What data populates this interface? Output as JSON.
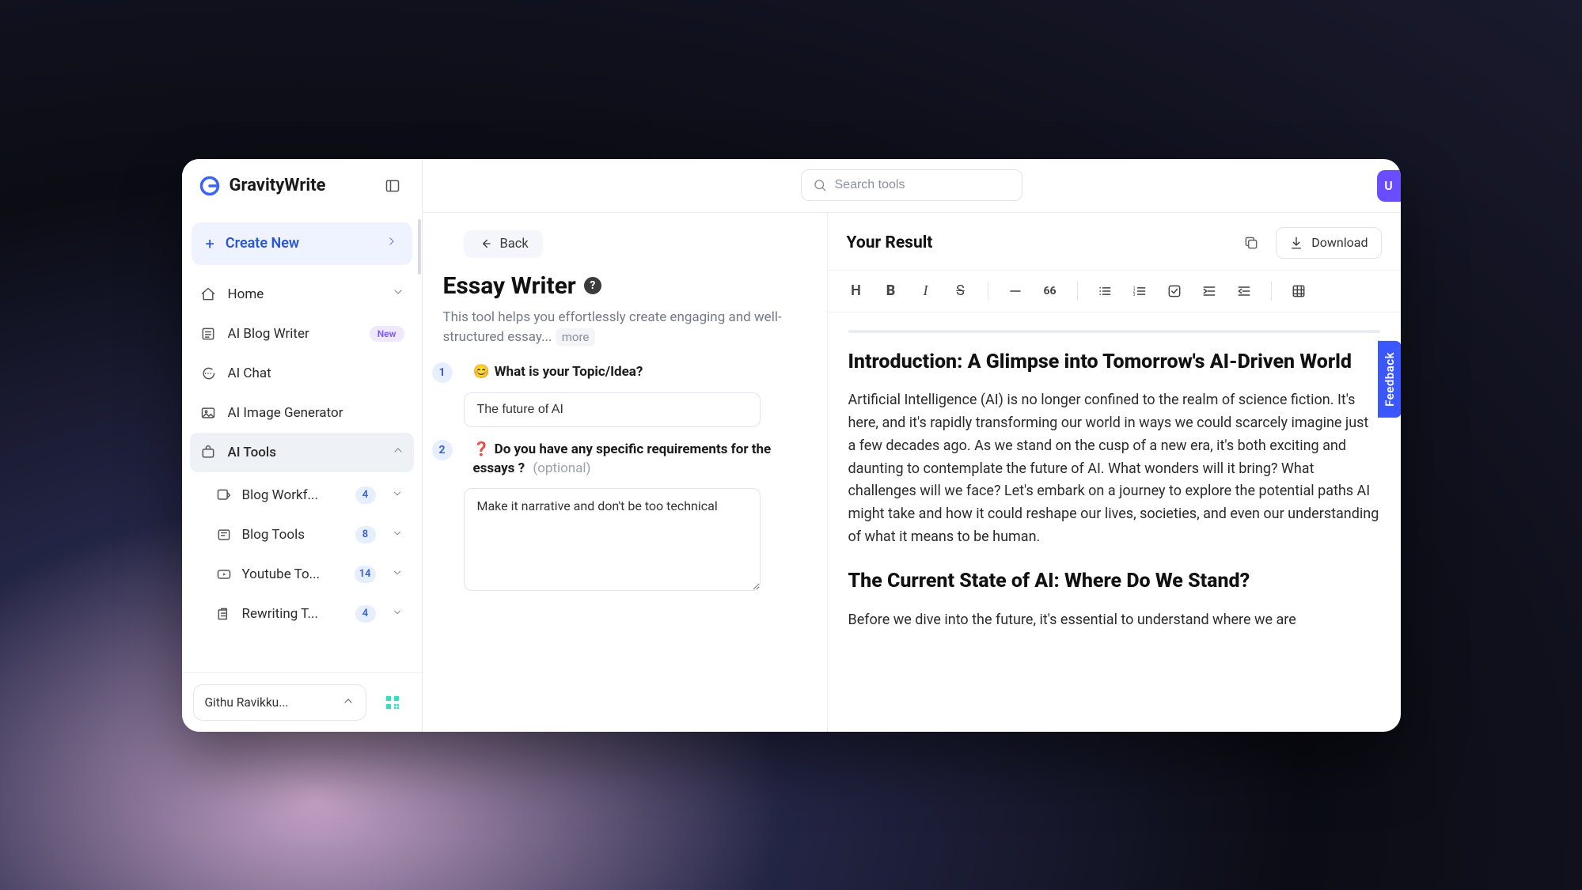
{
  "brand": {
    "name": "GravityWrite"
  },
  "search": {
    "placeholder": "Search tools"
  },
  "upgrade": {
    "label_initial": "U"
  },
  "sidebar": {
    "create_new": "Create New",
    "items": [
      {
        "label": "Home"
      },
      {
        "label": "AI Blog Writer",
        "badge": "New"
      },
      {
        "label": "AI Chat"
      },
      {
        "label": "AI Image Generator"
      },
      {
        "label": "AI Tools"
      }
    ],
    "ai_tools_children": [
      {
        "label": "Blog Workf...",
        "count": "4"
      },
      {
        "label": "Blog Tools",
        "count": "8"
      },
      {
        "label": "Youtube To...",
        "count": "14"
      },
      {
        "label": "Rewriting T...",
        "count": "4"
      }
    ],
    "user": "Githu Ravikku..."
  },
  "form": {
    "back": "Back",
    "title": "Essay Writer",
    "description": "This tool helps you effortlessly create engaging and well-structured essay...",
    "more": "more",
    "q1": {
      "num": "1",
      "emoji": "😊",
      "label": "What is your Topic/Idea?",
      "value": "The future of AI"
    },
    "q2": {
      "num": "2",
      "emoji": "❓",
      "label": "Do you have any specific requirements for the essays ?",
      "optional": "(optional)",
      "value": "Make it narrative and don't be too technical"
    }
  },
  "result": {
    "title": "Your Result",
    "download": "Download",
    "toolbar": {
      "quote": "66"
    },
    "heading1": "Introduction: A Glimpse into Tomorrow's AI-Driven World",
    "para1": "Artificial Intelligence (AI) is no longer confined to the realm of science fiction. It's here, and it's rapidly transforming our world in ways we could scarcely imagine just a few decades ago. As we stand on the cusp of a new era, it's both exciting and daunting to contemplate the future of AI. What wonders will it bring? What challenges will we face? Let's embark on a journey to explore the potential paths AI might take and how it could reshape our lives, societies, and even our understanding of what it means to be human.",
    "heading2": "The Current State of AI: Where Do We Stand?",
    "para2": "Before we dive into the future, it's essential to understand where we are"
  },
  "feedback": {
    "label": "Feedback"
  }
}
